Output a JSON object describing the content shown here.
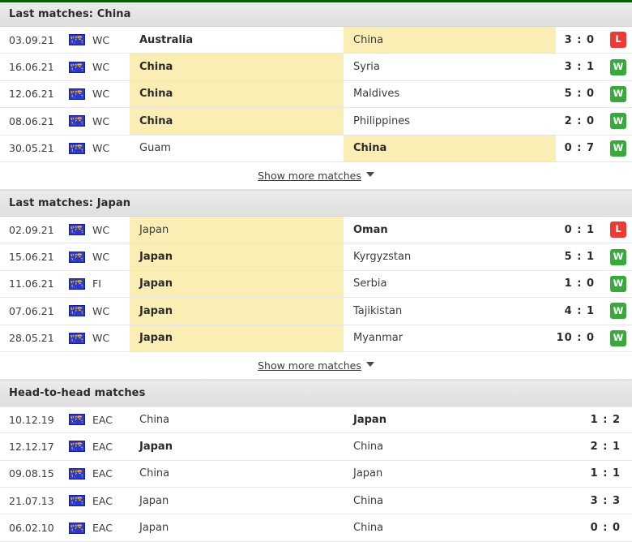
{
  "icons": {
    "flag": "world-map-flag-icon",
    "caret": "chevron-down-icon"
  },
  "colors": {
    "accent_green": "#0a5c0a",
    "win": "#3aa93d",
    "loss": "#ec3b34",
    "highlight": "#faeeb4",
    "header_bg": "#e6e6e6"
  },
  "sections": [
    {
      "id": "last-matches-china",
      "title": "Last matches: China",
      "has_green_top": true,
      "show_more": {
        "label": "Show more matches"
      },
      "rows": [
        {
          "date": "03.09.21",
          "comp": "WC",
          "home": "Australia",
          "away": "China",
          "home_bold": true,
          "away_bold": false,
          "home_hl": false,
          "away_hl": true,
          "score": "3 : 0",
          "result": "L"
        },
        {
          "date": "16.06.21",
          "comp": "WC",
          "home": "China",
          "away": "Syria",
          "home_bold": true,
          "away_bold": false,
          "home_hl": true,
          "away_hl": false,
          "score": "3 : 1",
          "result": "W"
        },
        {
          "date": "12.06.21",
          "comp": "WC",
          "home": "China",
          "away": "Maldives",
          "home_bold": true,
          "away_bold": false,
          "home_hl": true,
          "away_hl": false,
          "score": "5 : 0",
          "result": "W"
        },
        {
          "date": "08.06.21",
          "comp": "WC",
          "home": "China",
          "away": "Philippines",
          "home_bold": true,
          "away_bold": false,
          "home_hl": true,
          "away_hl": false,
          "score": "2 : 0",
          "result": "W"
        },
        {
          "date": "30.05.21",
          "comp": "WC",
          "home": "Guam",
          "away": "China",
          "home_bold": false,
          "away_bold": true,
          "home_hl": false,
          "away_hl": true,
          "score": "0 : 7",
          "result": "W"
        }
      ]
    },
    {
      "id": "last-matches-japan",
      "title": "Last matches: Japan",
      "has_green_top": false,
      "show_more": {
        "label": "Show more matches"
      },
      "rows": [
        {
          "date": "02.09.21",
          "comp": "WC",
          "home": "Japan",
          "away": "Oman",
          "home_bold": false,
          "away_bold": true,
          "home_hl": true,
          "away_hl": false,
          "score": "0 : 1",
          "result": "L"
        },
        {
          "date": "15.06.21",
          "comp": "WC",
          "home": "Japan",
          "away": "Kyrgyzstan",
          "home_bold": true,
          "away_bold": false,
          "home_hl": true,
          "away_hl": false,
          "score": "5 : 1",
          "result": "W"
        },
        {
          "date": "11.06.21",
          "comp": "FI",
          "home": "Japan",
          "away": "Serbia",
          "home_bold": true,
          "away_bold": false,
          "home_hl": true,
          "away_hl": false,
          "score": "1 : 0",
          "result": "W"
        },
        {
          "date": "07.06.21",
          "comp": "WC",
          "home": "Japan",
          "away": "Tajikistan",
          "home_bold": true,
          "away_bold": false,
          "home_hl": true,
          "away_hl": false,
          "score": "4 : 1",
          "result": "W"
        },
        {
          "date": "28.05.21",
          "comp": "WC",
          "home": "Japan",
          "away": "Myanmar",
          "home_bold": true,
          "away_bold": false,
          "home_hl": true,
          "away_hl": false,
          "score": "10 : 0",
          "result": "W"
        }
      ]
    },
    {
      "id": "head-to-head-matches",
      "title": "Head-to-head matches",
      "has_green_top": false,
      "show_more": null,
      "rows": [
        {
          "date": "10.12.19",
          "comp": "EAC",
          "home": "China",
          "away": "Japan",
          "home_bold": false,
          "away_bold": true,
          "home_hl": false,
          "away_hl": false,
          "score": "1 : 2",
          "result": ""
        },
        {
          "date": "12.12.17",
          "comp": "EAC",
          "home": "Japan",
          "away": "China",
          "home_bold": true,
          "away_bold": false,
          "home_hl": false,
          "away_hl": false,
          "score": "2 : 1",
          "result": ""
        },
        {
          "date": "09.08.15",
          "comp": "EAC",
          "home": "China",
          "away": "Japan",
          "home_bold": false,
          "away_bold": false,
          "home_hl": false,
          "away_hl": false,
          "score": "1 : 1",
          "result": ""
        },
        {
          "date": "21.07.13",
          "comp": "EAC",
          "home": "Japan",
          "away": "China",
          "home_bold": false,
          "away_bold": false,
          "home_hl": false,
          "away_hl": false,
          "score": "3 : 3",
          "result": ""
        },
        {
          "date": "06.02.10",
          "comp": "EAC",
          "home": "Japan",
          "away": "China",
          "home_bold": false,
          "away_bold": false,
          "home_hl": false,
          "away_hl": false,
          "score": "0 : 0",
          "result": ""
        }
      ]
    }
  ]
}
